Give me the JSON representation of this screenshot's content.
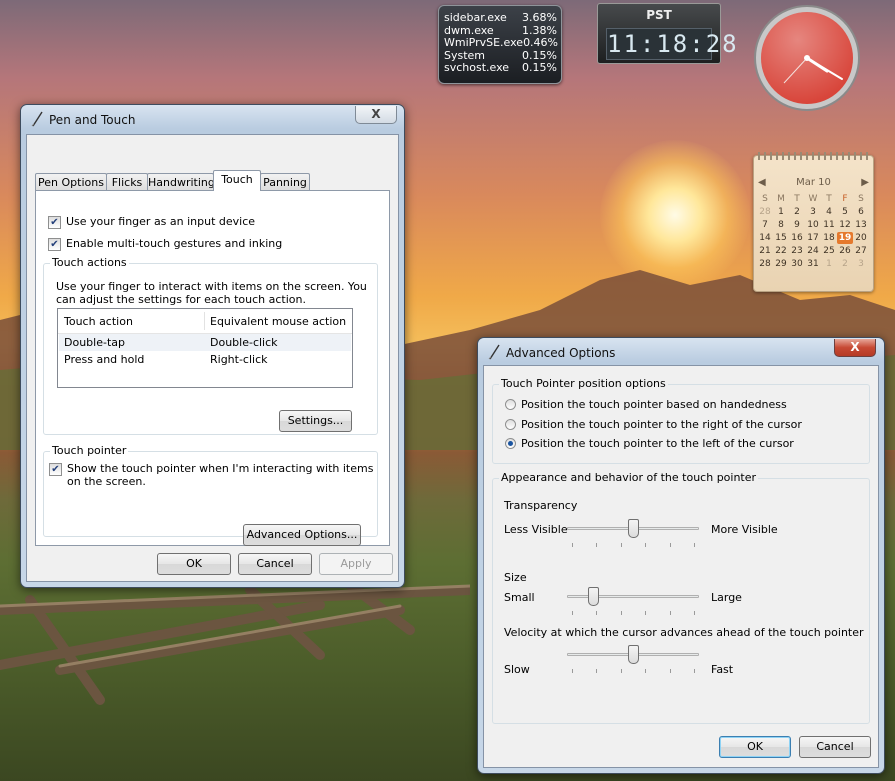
{
  "gadgets": {
    "cpu": {
      "rows": [
        {
          "name": "sidebar.exe",
          "value": "3.68%"
        },
        {
          "name": "dwm.exe",
          "value": "1.38%"
        },
        {
          "name": "WmiPrvSE.exe",
          "value": "0.46%"
        },
        {
          "name": "System",
          "value": "0.15%"
        },
        {
          "name": "svchost.exe",
          "value": "0.15%"
        }
      ]
    },
    "clock_digital": {
      "zone": "PST",
      "time": "11:18:28"
    },
    "calendar": {
      "month": "Mar 10",
      "days_of_week": [
        "S",
        "M",
        "T",
        "W",
        "T",
        "F",
        "S"
      ],
      "weeks": [
        [
          "28",
          "1",
          "2",
          "3",
          "4",
          "5",
          "6"
        ],
        [
          "7",
          "8",
          "9",
          "10",
          "11",
          "12",
          "13"
        ],
        [
          "14",
          "15",
          "16",
          "17",
          "18",
          "19",
          "20"
        ],
        [
          "21",
          "22",
          "23",
          "24",
          "25",
          "26",
          "27"
        ],
        [
          "28",
          "29",
          "30",
          "31",
          "1",
          "2",
          "3"
        ]
      ],
      "today": "19"
    }
  },
  "pen_touch": {
    "title": "Pen and Touch",
    "close": "X",
    "tabs": [
      "Pen Options",
      "Flicks",
      "Handwriting",
      "Touch",
      "Panning"
    ],
    "active_tab": "Touch",
    "checkbox_finger": "Use your finger as an input device",
    "checkbox_multitouch": "Enable multi-touch gestures and inking",
    "touch_actions": {
      "label": "Touch actions",
      "description_line1": "Use your finger to interact with items on the screen. You",
      "description_line2": "can adjust the settings for each touch action.",
      "columns": [
        "Touch action",
        "Equivalent mouse action"
      ],
      "rows": [
        {
          "action": "Double-tap",
          "mouse": "Double-click"
        },
        {
          "action": "Press and hold",
          "mouse": "Right-click"
        }
      ],
      "settings_button": "Settings..."
    },
    "touch_pointer": {
      "label": "Touch pointer",
      "checkbox_line1": "Show the touch pointer when I'm interacting with items",
      "checkbox_line2": "on the screen.",
      "advanced_button": "Advanced Options..."
    },
    "ok": "OK",
    "cancel": "Cancel",
    "apply": "Apply"
  },
  "advanced": {
    "title": "Advanced Options",
    "close": "X",
    "position_group": "Touch Pointer position options",
    "radio_handedness": "Position the touch pointer based on handedness",
    "radio_right": "Position the touch pointer to the right of the cursor",
    "radio_left": "Position the touch pointer to the left of the cursor",
    "selected_radio": "left",
    "appearance_group": "Appearance and behavior of the touch pointer",
    "transparency": {
      "label": "Transparency",
      "min": "Less Visible",
      "max": "More Visible",
      "level": 0.5
    },
    "size": {
      "label": "Size",
      "min": "Small",
      "max": "Large",
      "level": 0.17
    },
    "velocity": {
      "label": "Velocity at which the cursor advances ahead of the touch pointer",
      "min": "Slow",
      "max": "Fast",
      "level": 0.5
    },
    "ok": "OK",
    "cancel": "Cancel"
  }
}
